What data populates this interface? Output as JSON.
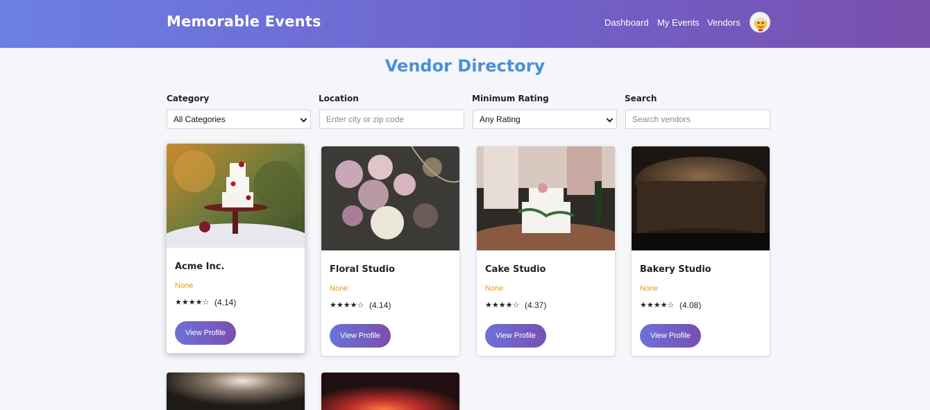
{
  "header": {
    "brand": "Memorable Events",
    "nav": [
      "Dashboard",
      "My Events",
      "Vendors"
    ],
    "avatar_icon": "user-avatar-icon"
  },
  "page": {
    "title": "Vendor Directory"
  },
  "filters": {
    "category": {
      "label": "Category",
      "value": "All Categories"
    },
    "location": {
      "label": "Location",
      "placeholder": "Enter city or zip code"
    },
    "rating": {
      "label": "Minimum Rating",
      "value": "Any Rating"
    },
    "search": {
      "label": "Search",
      "placeholder": "Search vendors"
    }
  },
  "vendors": [
    {
      "name": "Acme Inc.",
      "category": "None",
      "stars": "★★★★☆",
      "rating": "(4.14)",
      "button": "View Profile",
      "image": "wedding-cake-outdoor-photo"
    },
    {
      "name": "Floral Studio",
      "category": "None",
      "stars": "★★★★☆",
      "rating": "(4.14)",
      "button": "View Profile",
      "image": "flower-bouquet-photo"
    },
    {
      "name": "Cake Studio",
      "category": "None",
      "stars": "★★★★☆",
      "rating": "(4.37)",
      "button": "View Profile",
      "image": "cake-cutting-photo"
    },
    {
      "name": "Bakery Studio",
      "category": "None",
      "stars": "★★★★☆",
      "rating": "(4.08)",
      "button": "View Profile",
      "image": "baked-cake-photo"
    },
    {
      "image": "dim-candle-photo"
    },
    {
      "image": "fire-glow-photo"
    }
  ],
  "colors": {
    "header_start": "#6b7fe3",
    "header_end": "#7a4fad",
    "title": "#4a90d9",
    "category": "#e59a14"
  }
}
